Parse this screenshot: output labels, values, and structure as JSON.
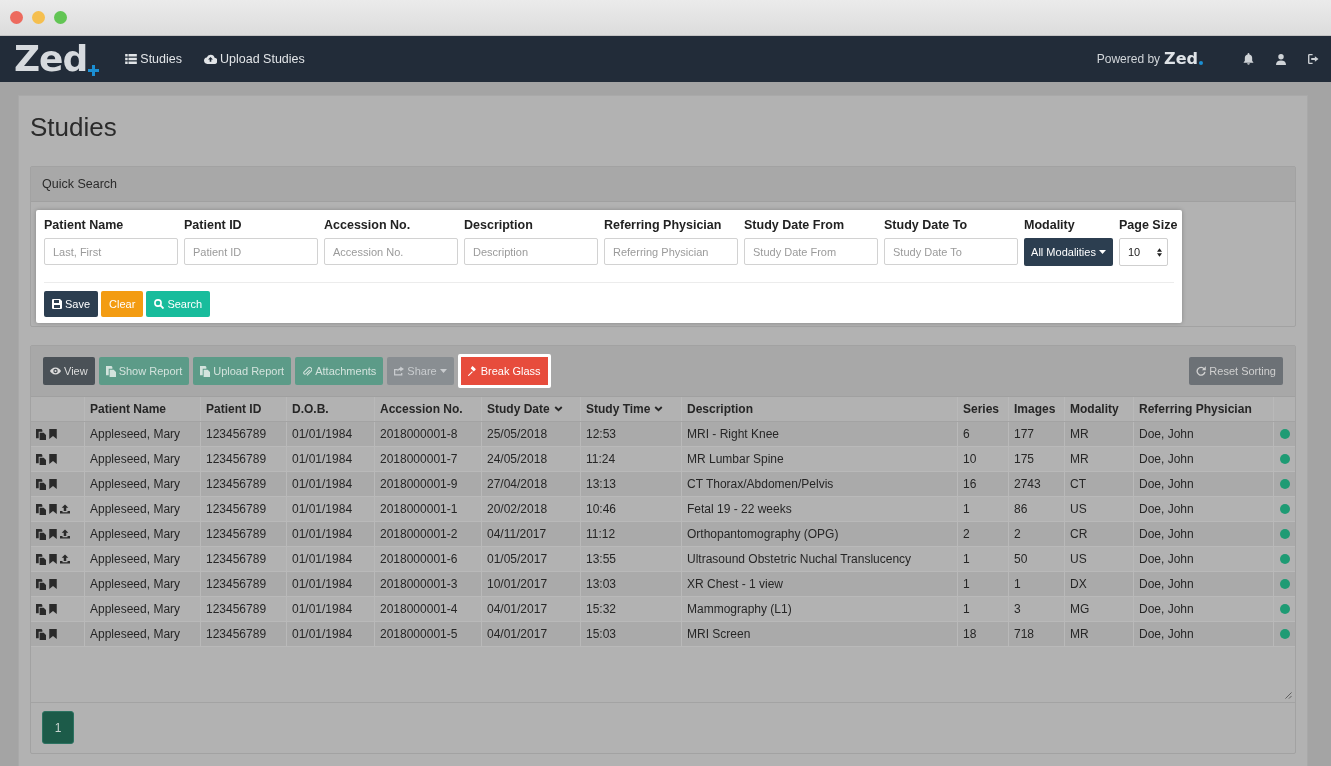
{
  "navbar": {
    "logo": "Zed",
    "items": [
      {
        "label": "Studies"
      },
      {
        "label": "Upload Studies"
      }
    ],
    "powered_by": "Powered by",
    "powered_logo": "Zed"
  },
  "page": {
    "title": "Studies"
  },
  "quick_search": {
    "title": "Quick Search",
    "highlighted": true,
    "fields": [
      {
        "label": "Patient Name",
        "kind": "text",
        "placeholder": "Last, First"
      },
      {
        "label": "Patient ID",
        "kind": "text",
        "placeholder": "Patient ID"
      },
      {
        "label": "Accession No.",
        "kind": "text",
        "placeholder": "Accession No."
      },
      {
        "label": "Description",
        "kind": "text",
        "placeholder": "Description"
      },
      {
        "label": "Referring Physician",
        "kind": "text",
        "placeholder": "Referring Physician"
      },
      {
        "label": "Study Date From",
        "kind": "text",
        "placeholder": "Study Date From"
      },
      {
        "label": "Study Date To",
        "kind": "text",
        "placeholder": "Study Date To"
      },
      {
        "label": "Modality",
        "kind": "dropdown",
        "value": "All Modalities"
      },
      {
        "label": "Page Size",
        "kind": "select",
        "value": "10"
      }
    ],
    "buttons": [
      {
        "label": "Save",
        "kind": "dark"
      },
      {
        "label": "Clear",
        "kind": "warning"
      },
      {
        "label": "Search",
        "kind": "success"
      }
    ]
  },
  "studies_table": {
    "toolbar": [
      {
        "label": "View",
        "kind": "dark",
        "dropdown": false,
        "highlighted": false
      },
      {
        "label": "Show Report",
        "kind": "teal",
        "dropdown": false,
        "highlighted": false
      },
      {
        "label": "Upload Report",
        "kind": "teal",
        "dropdown": false,
        "highlighted": false
      },
      {
        "label": "Attachments",
        "kind": "teal",
        "dropdown": false,
        "highlighted": false
      },
      {
        "label": "Share",
        "kind": "grey",
        "dropdown": true,
        "highlighted": false
      },
      {
        "label": "Break Glass",
        "kind": "danger",
        "dropdown": false,
        "highlighted": true
      }
    ],
    "reset_button": {
      "label": "Reset Sorting",
      "kind": "muted",
      "highlighted": false
    },
    "columns": [
      {
        "label": "Patient Name",
        "sorted": false
      },
      {
        "label": "Patient ID",
        "sorted": false
      },
      {
        "label": "D.O.B.",
        "sorted": false
      },
      {
        "label": "Accession No.",
        "sorted": false
      },
      {
        "label": "Study Date",
        "sorted": true
      },
      {
        "label": "Study Time",
        "sorted": true
      },
      {
        "label": "Description",
        "sorted": false
      },
      {
        "label": "Series",
        "sorted": false
      },
      {
        "label": "Images",
        "sorted": false
      },
      {
        "label": "Modality",
        "sorted": false
      },
      {
        "label": "Referring Physician",
        "sorted": false
      }
    ],
    "rows": [
      {
        "cells": [
          "Appleseed, Mary",
          "123456789",
          "01/01/1984",
          "2018000001-8",
          "25/05/2018",
          "12:53",
          "MRI - Right Knee",
          "6",
          "177",
          "MR",
          "Doe, John"
        ],
        "upload": false,
        "color": "#1e9b74"
      },
      {
        "cells": [
          "Appleseed, Mary",
          "123456789",
          "01/01/1984",
          "2018000001-7",
          "24/05/2018",
          "11:24",
          "MR Lumbar Spine",
          "10",
          "175",
          "MR",
          "Doe, John"
        ],
        "upload": false,
        "color": "#1e9b74"
      },
      {
        "cells": [
          "Appleseed, Mary",
          "123456789",
          "01/01/1984",
          "2018000001-9",
          "27/04/2018",
          "13:13",
          "CT Thorax/Abdomen/Pelvis",
          "16",
          "2743",
          "CT",
          "Doe, John"
        ],
        "upload": false,
        "color": "#1e9b74"
      },
      {
        "cells": [
          "Appleseed, Mary",
          "123456789",
          "01/01/1984",
          "2018000001-1",
          "20/02/2018",
          "10:46",
          "Fetal 19 - 22 weeks",
          "1",
          "86",
          "US",
          "Doe, John"
        ],
        "upload": true,
        "color": "#1e9b74"
      },
      {
        "cells": [
          "Appleseed, Mary",
          "123456789",
          "01/01/1984",
          "2018000001-2",
          "04/11/2017",
          "11:12",
          "Orthopantomography (OPG)",
          "2",
          "2",
          "CR",
          "Doe, John"
        ],
        "upload": true,
        "color": "#1e9b74"
      },
      {
        "cells": [
          "Appleseed, Mary",
          "123456789",
          "01/01/1984",
          "2018000001-6",
          "01/05/2017",
          "13:55",
          "Ultrasound Obstetric Nuchal Translucency",
          "1",
          "50",
          "US",
          "Doe, John"
        ],
        "upload": true,
        "color": "#1e9b74"
      },
      {
        "cells": [
          "Appleseed, Mary",
          "123456789",
          "01/01/1984",
          "2018000001-3",
          "10/01/2017",
          "13:03",
          "XR Chest - 1 view",
          "1",
          "1",
          "DX",
          "Doe, John"
        ],
        "upload": false,
        "color": "#1e9b74"
      },
      {
        "cells": [
          "Appleseed, Mary",
          "123456789",
          "01/01/1984",
          "2018000001-4",
          "04/01/2017",
          "15:32",
          "Mammography (L1)",
          "1",
          "3",
          "MG",
          "Doe, John"
        ],
        "upload": false,
        "color": "#1e9b74"
      },
      {
        "cells": [
          "Appleseed, Mary",
          "123456789",
          "01/01/1984",
          "2018000001-5",
          "04/01/2017",
          "15:03",
          "MRI Screen",
          "18",
          "718",
          "MR",
          "Doe, John"
        ],
        "upload": false,
        "color": "#1e9b74"
      }
    ],
    "pagination": [
      {
        "label": "1",
        "selected": true
      }
    ]
  }
}
